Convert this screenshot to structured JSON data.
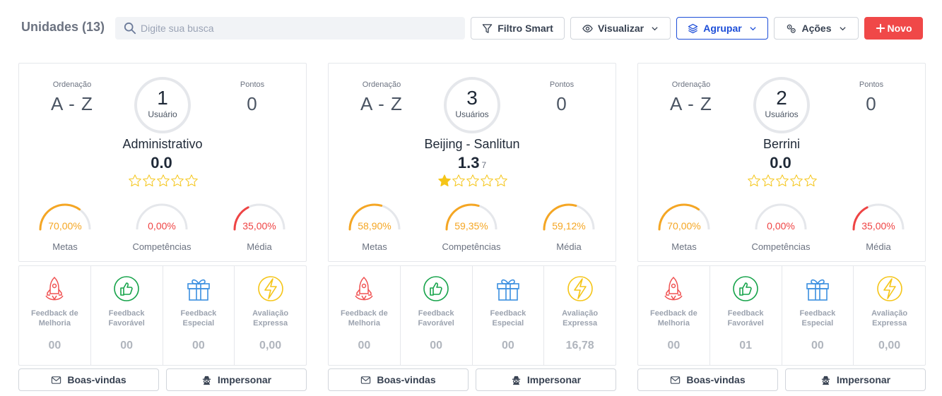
{
  "header": {
    "title": "Unidades (13)",
    "search_placeholder": "Digite sua busca",
    "filter_label": "Filtro Smart",
    "view_label": "Visualizar",
    "group_label": "Agrupar",
    "actions_label": "Ações",
    "new_label": "Novo"
  },
  "labels": {
    "ordering": "Ordenação",
    "points": "Pontos",
    "metas": "Metas",
    "competencias": "Competências",
    "media": "Média",
    "fb_melhoria": "Feedback de Melhoria",
    "fb_favoravel": "Feedback Favorável",
    "fb_especial": "Feedback Especial",
    "avaliacao": "Avaliação Expressa",
    "welcome": "Boas-vindas",
    "impersonate": "Impersonar"
  },
  "colors": {
    "orange": "#f5a623",
    "red": "#ef4444",
    "gauge_track": "#e5e7eb",
    "fb_red": "#f05252",
    "fb_green": "#16a34a",
    "fb_blue": "#3b8fe0",
    "fb_yellow": "#f5c518"
  },
  "units": [
    {
      "ordering": "A - Z",
      "points": "0",
      "users_count": "1",
      "users_label": "Usuário",
      "name": "Administrativo",
      "score": "0.0",
      "score_sub": "",
      "stars_filled": 0,
      "gauges": [
        {
          "value": 70.0,
          "label": "70,00%",
          "color": "#f5a623"
        },
        {
          "value": 0.0,
          "label": "0,00%",
          "color": "#ef4444"
        },
        {
          "value": 35.0,
          "label": "35,00%",
          "color": "#ef4444"
        }
      ],
      "feedback": [
        "00",
        "00",
        "00",
        "0,00"
      ]
    },
    {
      "ordering": "A - Z",
      "points": "0",
      "users_count": "3",
      "users_label": "Usuários",
      "name": "Beijing - Sanlitun",
      "score": "1.3",
      "score_sub": "7",
      "stars_filled": 1,
      "gauges": [
        {
          "value": 58.9,
          "label": "58,90%",
          "color": "#f5a623"
        },
        {
          "value": 59.35,
          "label": "59,35%",
          "color": "#f5a623"
        },
        {
          "value": 59.12,
          "label": "59,12%",
          "color": "#f5a623"
        }
      ],
      "feedback": [
        "00",
        "00",
        "00",
        "16,78"
      ]
    },
    {
      "ordering": "A - Z",
      "points": "0",
      "users_count": "2",
      "users_label": "Usuários",
      "name": "Berrini",
      "score": "0.0",
      "score_sub": "",
      "stars_filled": 0,
      "gauges": [
        {
          "value": 70.0,
          "label": "70,00%",
          "color": "#f5a623"
        },
        {
          "value": 0.0,
          "label": "0,00%",
          "color": "#ef4444"
        },
        {
          "value": 35.0,
          "label": "35,00%",
          "color": "#ef4444"
        }
      ],
      "feedback": [
        "00",
        "01",
        "00",
        "0,00"
      ]
    }
  ]
}
